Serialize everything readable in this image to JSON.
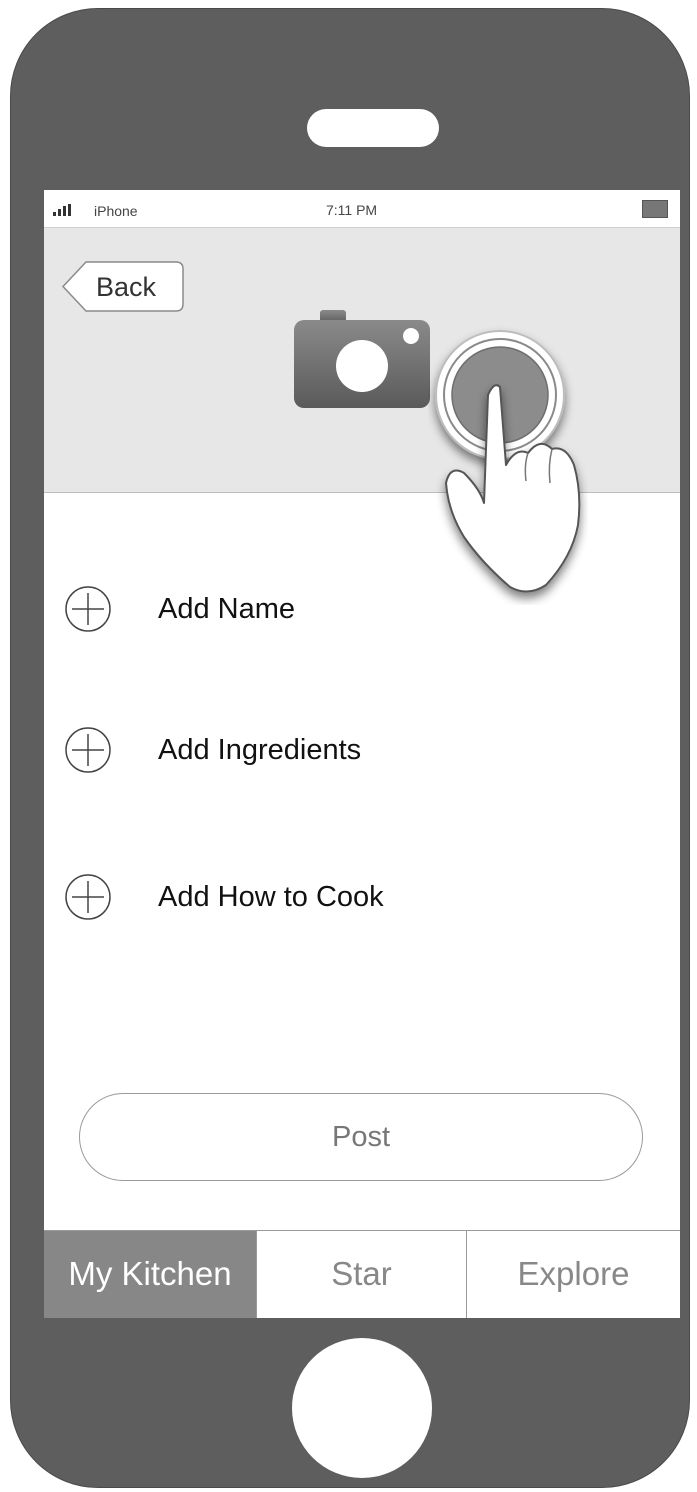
{
  "status_bar": {
    "carrier": "iPhone",
    "time": "7:11 PM",
    "signal_icon": "signal-bars-icon",
    "battery_icon": "battery-icon"
  },
  "header": {
    "back_label": "Back",
    "photo_icon": "camera-icon"
  },
  "form_items": [
    {
      "label": "Add Name",
      "icon": "plus-circle-icon"
    },
    {
      "label": "Add Ingredients",
      "icon": "plus-circle-icon"
    },
    {
      "label": "Add How to Cook",
      "icon": "plus-circle-icon"
    }
  ],
  "post_button": {
    "label": "Post"
  },
  "tab_bar": {
    "tabs": [
      {
        "label": "My Kitchen",
        "active": true
      },
      {
        "label": "Star",
        "active": false
      },
      {
        "label": "Explore",
        "active": false
      }
    ]
  },
  "gesture_hint": {
    "icon": "tap-hand-icon"
  },
  "colors": {
    "phone_body": "#5e5e5e",
    "header_bg": "#e7e7e7",
    "active_tab_bg": "#878787",
    "camera": "#777777"
  }
}
